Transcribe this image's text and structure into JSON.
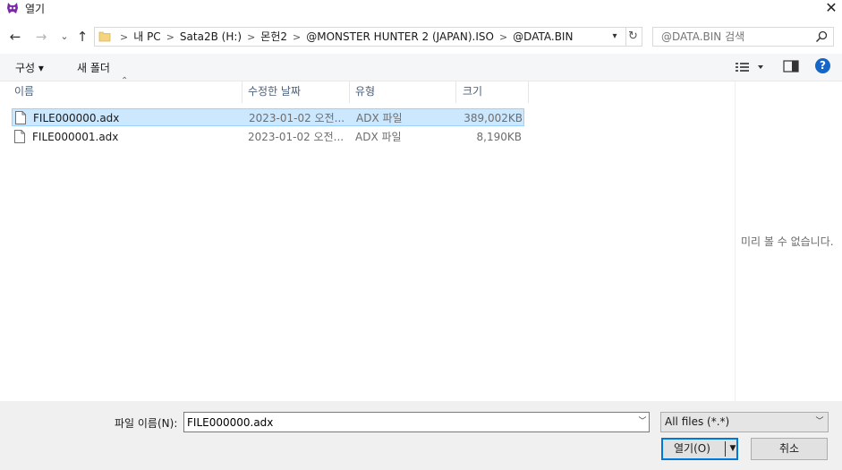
{
  "window": {
    "title": "열기"
  },
  "nav": {
    "back": "←",
    "forward": "→",
    "recent": "⌄",
    "up": "↑"
  },
  "address": {
    "crumbs": [
      "내 PC",
      "Sata2B (H:)",
      "몬헌2",
      "@MONSTER HUNTER 2 (JAPAN).ISO",
      "@DATA.BIN"
    ]
  },
  "search": {
    "placeholder": "@DATA.BIN 검색"
  },
  "toolbar": {
    "organize": "구성 ▾",
    "new_folder": "새 폴더"
  },
  "columns": {
    "name": "이름",
    "date": "수정한 날짜",
    "type": "유형",
    "size": "크기"
  },
  "files": [
    {
      "name": "FILE000000.adx",
      "date": "2023-01-02 오전...",
      "type": "ADX 파일",
      "size": "389,002KB",
      "selected": true
    },
    {
      "name": "FILE000001.adx",
      "date": "2023-01-02 오전...",
      "type": "ADX 파일",
      "size": "8,190KB",
      "selected": false
    }
  ],
  "preview": {
    "empty_text": "미리 볼 수 없습니다."
  },
  "footer": {
    "filename_label": "파일 이름(N):",
    "filename_value": "FILE000000.adx",
    "filter_value": "All files (*.*)",
    "open_label": "열기(O)",
    "cancel_label": "취소"
  },
  "colors": {
    "accent": "#0078d7",
    "selection": "#cce8ff",
    "help": "#1467c8"
  }
}
